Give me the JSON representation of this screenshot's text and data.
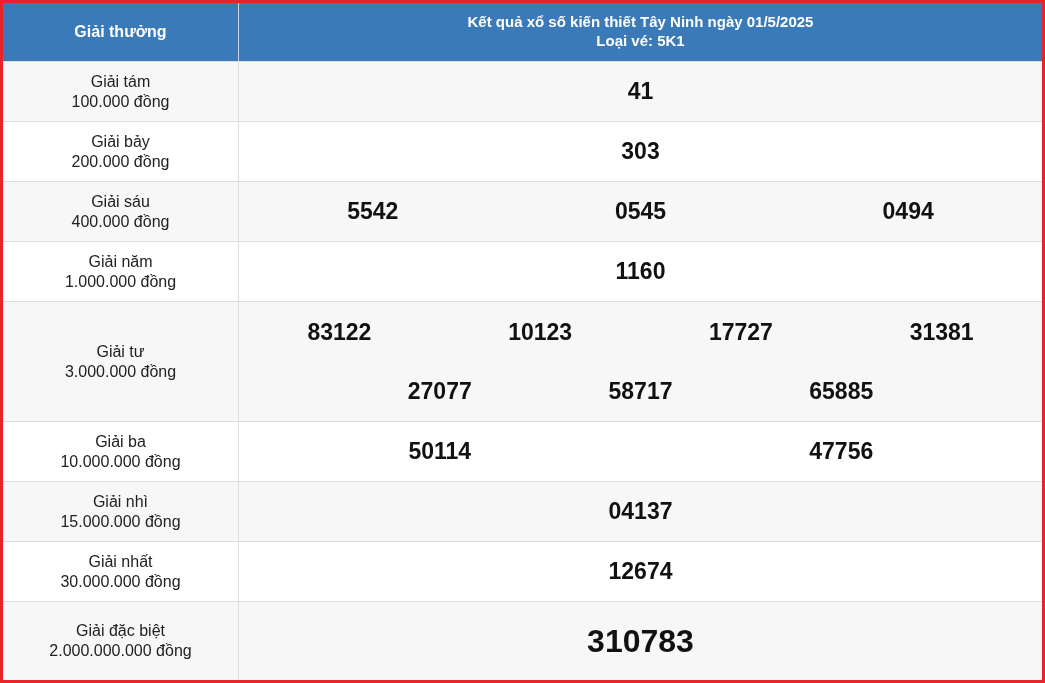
{
  "header": {
    "prize_column": "Giải thưởng",
    "title": "Kết quả xổ số kiến thiết Tây Ninh ngày 01/5/2025",
    "ticket_type": "Loại vé: 5K1"
  },
  "rows": [
    {
      "name": "Giải tám",
      "amount": "100.000 đồng",
      "kind": "normal",
      "numbers": [
        "41"
      ]
    },
    {
      "name": "Giải bảy",
      "amount": "200.000 đồng",
      "kind": "normal",
      "numbers": [
        "303"
      ]
    },
    {
      "name": "Giải sáu",
      "amount": "400.000 đồng",
      "kind": "normal",
      "numbers": [
        "5542",
        "0545",
        "0494"
      ]
    },
    {
      "name": "Giải năm",
      "amount": "1.000.000 đồng",
      "kind": "normal",
      "numbers": [
        "1160"
      ]
    },
    {
      "name": "Giải tư",
      "amount": "3.000.000 đồng",
      "kind": "normal",
      "numbers": [
        "83122",
        "10123",
        "17727",
        "31381",
        "27077",
        "58717",
        "65885"
      ]
    },
    {
      "name": "Giải ba",
      "amount": "10.000.000 đồng",
      "kind": "normal",
      "numbers": [
        "50114",
        "47756"
      ]
    },
    {
      "name": "Giải nhì",
      "amount": "15.000.000 đồng",
      "kind": "normal",
      "numbers": [
        "04137"
      ]
    },
    {
      "name": "Giải nhất",
      "amount": "30.000.000 đồng",
      "kind": "normal",
      "numbers": [
        "12674"
      ]
    },
    {
      "name": "Giải đặc biệt",
      "amount": "2.000.000.000 đồng",
      "kind": "special",
      "numbers": [
        "310783"
      ]
    }
  ]
}
